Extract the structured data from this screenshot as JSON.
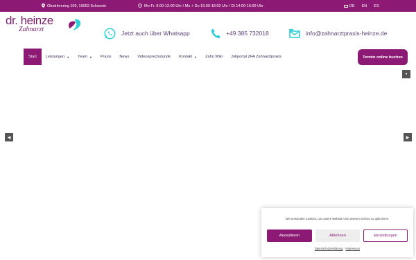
{
  "topbar": {
    "address": "Obotritenring 109, 19053 Schwerin",
    "hours": "Mo-Fr. 8:00-12:00 Uhr / Mo + Do 15:00-18:00 Uhr / Di 14:00-16:00 Uhr",
    "languages": [
      "DE",
      "EN",
      "ES"
    ]
  },
  "header": {
    "logo_main": "dr. heinze",
    "logo_sub": "Zahnarzt",
    "whatsapp": "Jetzt auch über Whatsapp",
    "phone": "+49 385 732018",
    "email": "info@zahnarztpraxis-heinze.de"
  },
  "nav": {
    "items": [
      {
        "label": "Start",
        "dropdown": false
      },
      {
        "label": "Leistungen",
        "dropdown": true
      },
      {
        "label": "Team",
        "dropdown": true
      },
      {
        "label": "Praxis",
        "dropdown": false
      },
      {
        "label": "News",
        "dropdown": false
      },
      {
        "label": "Videosprechstunde",
        "dropdown": false
      },
      {
        "label": "Kontakt",
        "dropdown": true
      },
      {
        "label": "Zahn Wiki",
        "dropdown": false
      },
      {
        "label": "Jobportal ZFA Zahnarztpraxis",
        "dropdown": false
      }
    ],
    "cta": "Termin online buchen"
  },
  "slider": {
    "pause": "⏸",
    "prev": "◀",
    "next": "▶"
  },
  "cookie": {
    "text": "Wir verwenden Cookies, um unsere Website und unseren Service zu optimieren.",
    "accept": "Akzeptieren",
    "decline": "Ablehnen",
    "settings": "Einstellungen",
    "privacy": "Datenschutzerklärung",
    "separator": "·",
    "imprint": "Impressum"
  },
  "colors": {
    "brand": "#8c1a75",
    "text_nav": "#3d2b55",
    "accent_cyan": "#2ed0d8"
  }
}
